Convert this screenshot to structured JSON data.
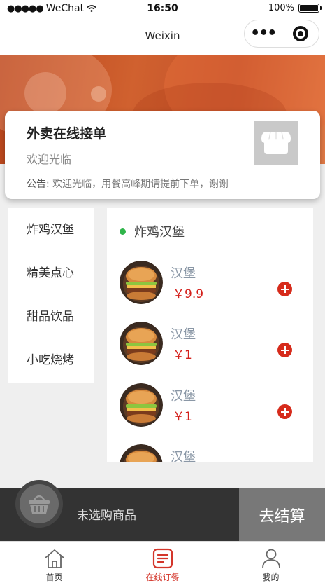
{
  "status_bar": {
    "carrier": "WeChat",
    "signal": "●●●●●",
    "time": "16:50",
    "battery": "100%"
  },
  "nav": {
    "title": "Weixin",
    "more_glyph": "•••"
  },
  "shop": {
    "name": "外卖在线接单",
    "welcome": "欢迎光临",
    "notice_label": "公告:",
    "notice_text": "欢迎光临，用餐高峰期请提前下单，谢谢"
  },
  "categories": [
    {
      "label": "炸鸡汉堡"
    },
    {
      "label": "精美点心"
    },
    {
      "label": "甜品饮品"
    },
    {
      "label": "小吃烧烤"
    }
  ],
  "menu": {
    "section_title": "炸鸡汉堡",
    "products": [
      {
        "name": "汉堡",
        "price": "￥9.9"
      },
      {
        "name": "汉堡",
        "price": "￥1"
      },
      {
        "name": "汉堡",
        "price": "￥1"
      },
      {
        "name": "汉堡",
        "price": ""
      }
    ]
  },
  "cart": {
    "empty_text": "未选购商品",
    "checkout_label": "去结算"
  },
  "tabs": [
    {
      "label": "首页",
      "icon": "home-icon"
    },
    {
      "label": "在线订餐",
      "icon": "order-icon",
      "active": true
    },
    {
      "label": "我的",
      "icon": "person-icon"
    }
  ],
  "colors": {
    "accent_red": "#d62b1b",
    "price_red": "#d4201b",
    "active_tab": "#d4362b",
    "banner": "#c2502a",
    "green_dot": "#2fb54a"
  }
}
